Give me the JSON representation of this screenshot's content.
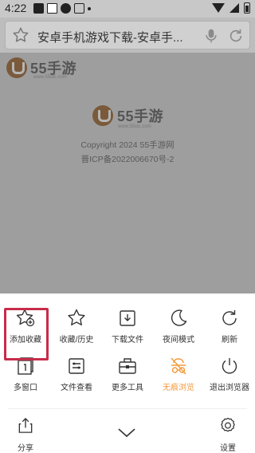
{
  "status_bar": {
    "time": "4:22",
    "icons": [
      "photo-icon",
      "square-icon",
      "notification-icon",
      "a-icon",
      "wifi-icon",
      "signal-icon",
      "battery-icon"
    ]
  },
  "address_bar": {
    "title": "安卓手机游戏下载-安卓手..."
  },
  "page": {
    "brand": "55手游",
    "brand_sub": "www.55idc.com",
    "copyright": "Copyright 2024 55手游网",
    "icp": "晋ICP备2022006670号-2"
  },
  "menu": {
    "row1": [
      {
        "label": "添加收藏",
        "icon": "star-add-icon"
      },
      {
        "label": "收藏/历史",
        "icon": "star-icon"
      },
      {
        "label": "下载文件",
        "icon": "download-folder-icon"
      },
      {
        "label": "夜间模式",
        "icon": "moon-icon"
      },
      {
        "label": "刷新",
        "icon": "refresh-icon"
      }
    ],
    "row2": [
      {
        "label": "多窗口",
        "icon": "windows-icon"
      },
      {
        "label": "文件查看",
        "icon": "file-view-icon"
      },
      {
        "label": "更多工具",
        "icon": "toolbox-icon"
      },
      {
        "label": "无痕浏览",
        "icon": "incognito-icon"
      },
      {
        "label": "退出浏览器",
        "icon": "power-icon"
      }
    ],
    "bottom": {
      "share_label": "分享",
      "settings_label": "设置"
    },
    "active_color": "#f39a3c",
    "highlight_color": "#c62c4a"
  }
}
